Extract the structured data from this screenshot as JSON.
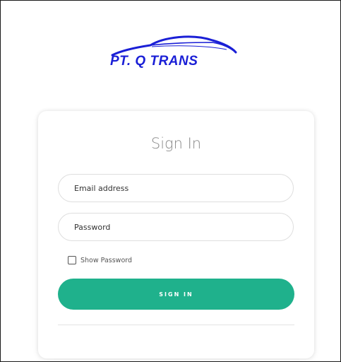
{
  "brand": {
    "name": "PT. Q TRANS",
    "color": "#1a1fd6"
  },
  "login": {
    "title": "Sign In",
    "email_placeholder": "Email address",
    "password_placeholder": "Password",
    "show_password_label": "Show Password",
    "show_password_checked": false,
    "submit_label": "SIGN IN",
    "submit_color": "#1fb18c"
  }
}
